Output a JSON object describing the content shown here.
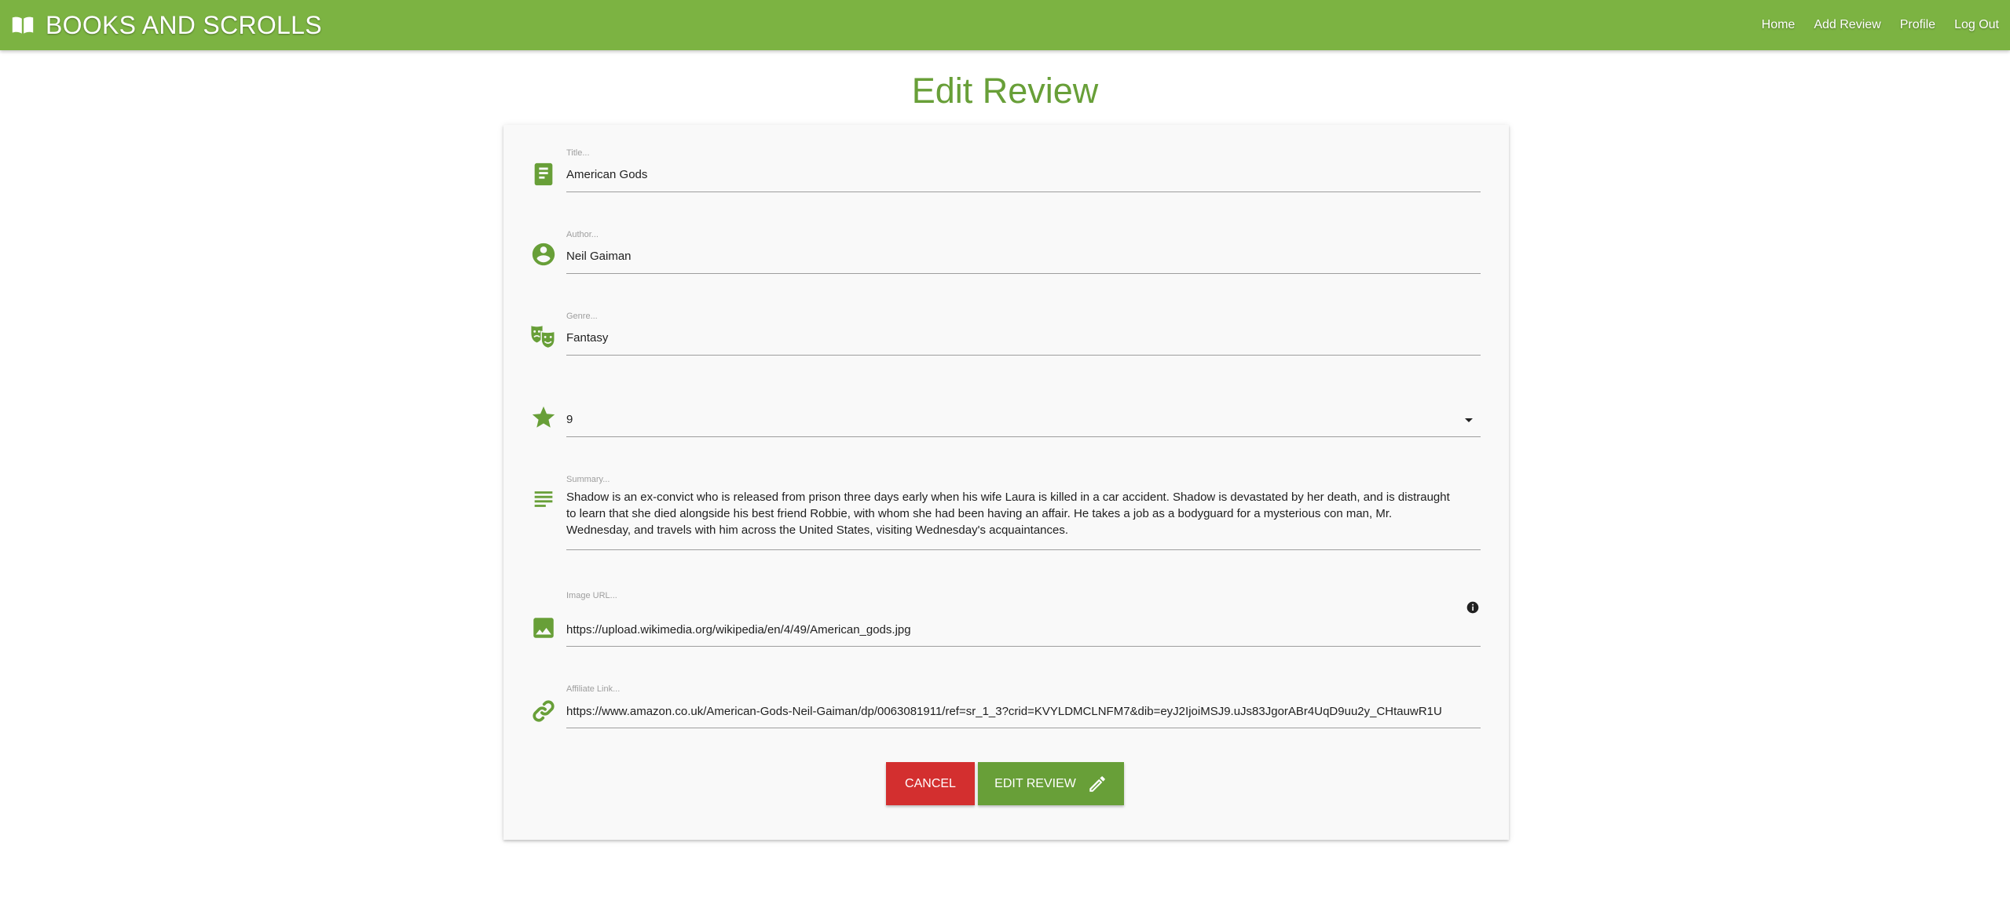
{
  "navbar": {
    "brand": "BOOKS AND SCROLLS",
    "links": [
      "Home",
      "Add Review",
      "Profile",
      "Log Out"
    ]
  },
  "page": {
    "title": "Edit Review"
  },
  "form": {
    "title": {
      "label": "Title...",
      "value": "American Gods",
      "icon": "book-icon"
    },
    "author": {
      "label": "Author...",
      "value": "Neil Gaiman",
      "icon": "account-circle-icon"
    },
    "genre": {
      "label": "Genre...",
      "value": "Fantasy",
      "icon": "theater-masks-icon"
    },
    "rating": {
      "value": "9",
      "icon": "star-icon"
    },
    "summary": {
      "label": "Summary...",
      "value": "Shadow is an ex-convict who is released from prison three days early when his wife Laura is killed in a car accident. Shadow is devastated by her death, and is distraught to learn that she died alongside his best friend Robbie, with whom she had been having an affair. He takes a job as a bodyguard for a mysterious con man, Mr. Wednesday, and travels with him across the United States, visiting Wednesday's acquaintances.",
      "icon": "subject-icon"
    },
    "image_url": {
      "label": "Image URL...",
      "value": "https://upload.wikimedia.org/wikipedia/en/4/49/American_gods.jpg",
      "icon": "image-icon"
    },
    "affiliate": {
      "label": "Affiliate Link...",
      "value": "https://www.amazon.co.uk/American-Gods-Neil-Gaiman/dp/0063081911/ref=sr_1_3?crid=KVYLDMCLNFM7&dib=eyJ2IjoiMSJ9.uJs83JgorABr4UqD9uu2y_CHtauwR1U",
      "icon": "link-icon"
    }
  },
  "buttons": {
    "cancel": "Cancel",
    "edit": "Edit Review"
  },
  "colors": {
    "navbar": "#7cb342",
    "accent": "#689f38",
    "cancel": "#d32f2f",
    "card": "#f9f9f9"
  }
}
